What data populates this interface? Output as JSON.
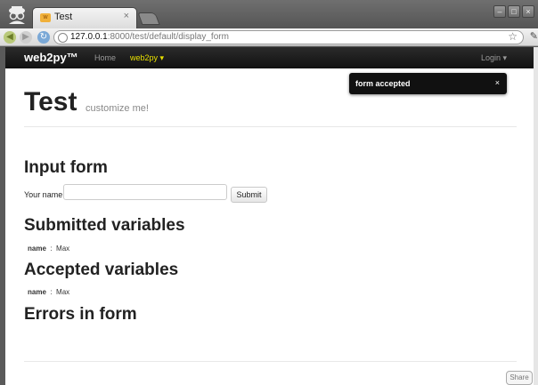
{
  "browser": {
    "tab_title": "Test",
    "tab_close": "×",
    "url_host": "127.0.0.1",
    "url_rest": ":8000/test/default/display_form",
    "star_icon": "☆",
    "wrench_icon": "🔧"
  },
  "navbar": {
    "brand": "web2py™",
    "home": "Home",
    "web2py_menu": "web2py ▾",
    "login": "Login ▾"
  },
  "flash": {
    "message": "form accepted",
    "close": "×"
  },
  "header": {
    "title": "Test",
    "subtitle": "customize me!"
  },
  "input_form": {
    "heading": "Input form",
    "label": "Your name:",
    "value": "",
    "submit": "Submit"
  },
  "submitted": {
    "heading": "Submitted variables",
    "key": "name",
    "separator": ":",
    "value": "Max"
  },
  "accepted": {
    "heading": "Accepted variables",
    "key": "name",
    "separator": ":",
    "value": "Max"
  },
  "errors": {
    "heading": "Errors in form"
  },
  "footer": {
    "share": "Share"
  }
}
